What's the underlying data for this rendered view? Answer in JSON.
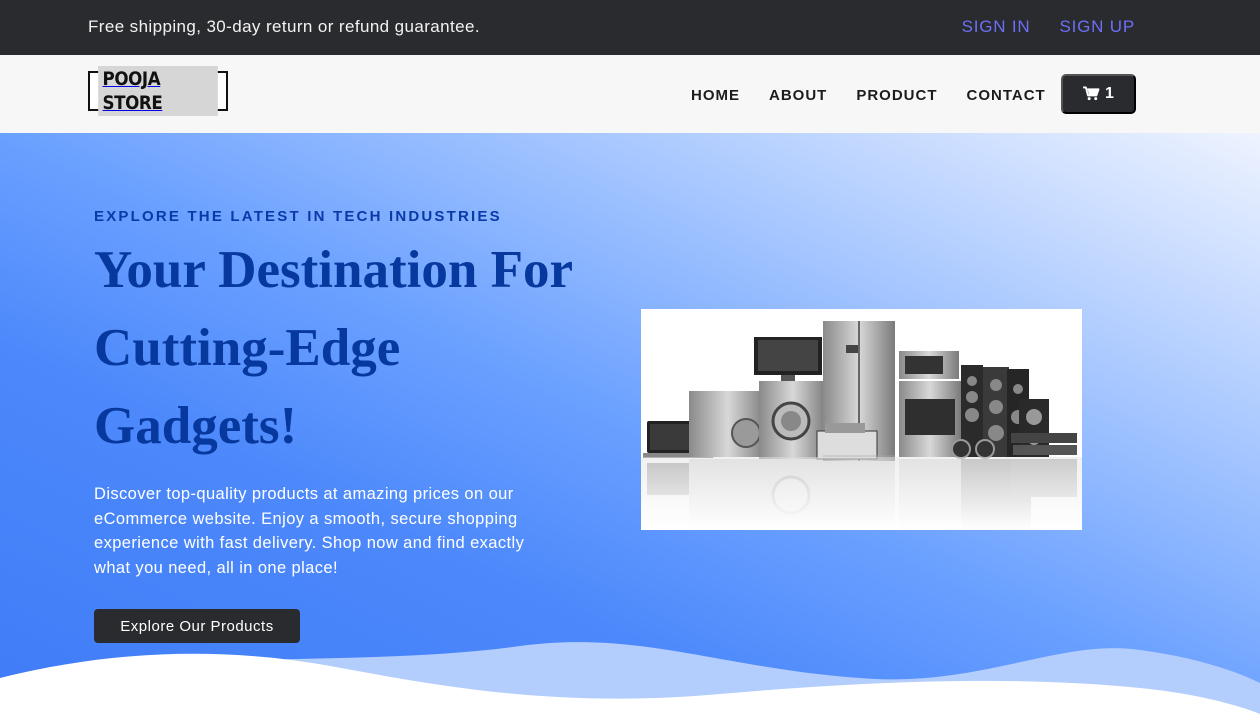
{
  "topbar": {
    "promo": "Free shipping, 30-day return or refund guarantee.",
    "sign_in": "SIGN IN",
    "sign_up": "SIGN UP"
  },
  "nav": {
    "logo": "POOJA STORE",
    "items": [
      {
        "label": "HOME"
      },
      {
        "label": "ABOUT"
      },
      {
        "label": "PRODUCT"
      },
      {
        "label": "CONTACT"
      }
    ],
    "cart_icon": "shopping-cart-icon",
    "cart_count": "1"
  },
  "hero": {
    "eyebrow": "EXPLORE THE LATEST IN TECH INDUSTRIES",
    "headline": "Your Destination For Cutting-Edge Gadgets!",
    "description": "Discover top-quality products at amazing prices on our eCommerce website. Enjoy a smooth, secure shopping experience with fast delivery. Shop now and find exactly what you need, all in one place!",
    "cta": "Explore Our Products"
  },
  "colors": {
    "topbar_bg": "#2a2b2f",
    "auth_link": "#6c6ff7",
    "heading_blue": "#06389e",
    "hero_gradient_start": "#eef3ff",
    "hero_gradient_end": "#3f7bf6",
    "button_bg": "#2a2b2f"
  }
}
